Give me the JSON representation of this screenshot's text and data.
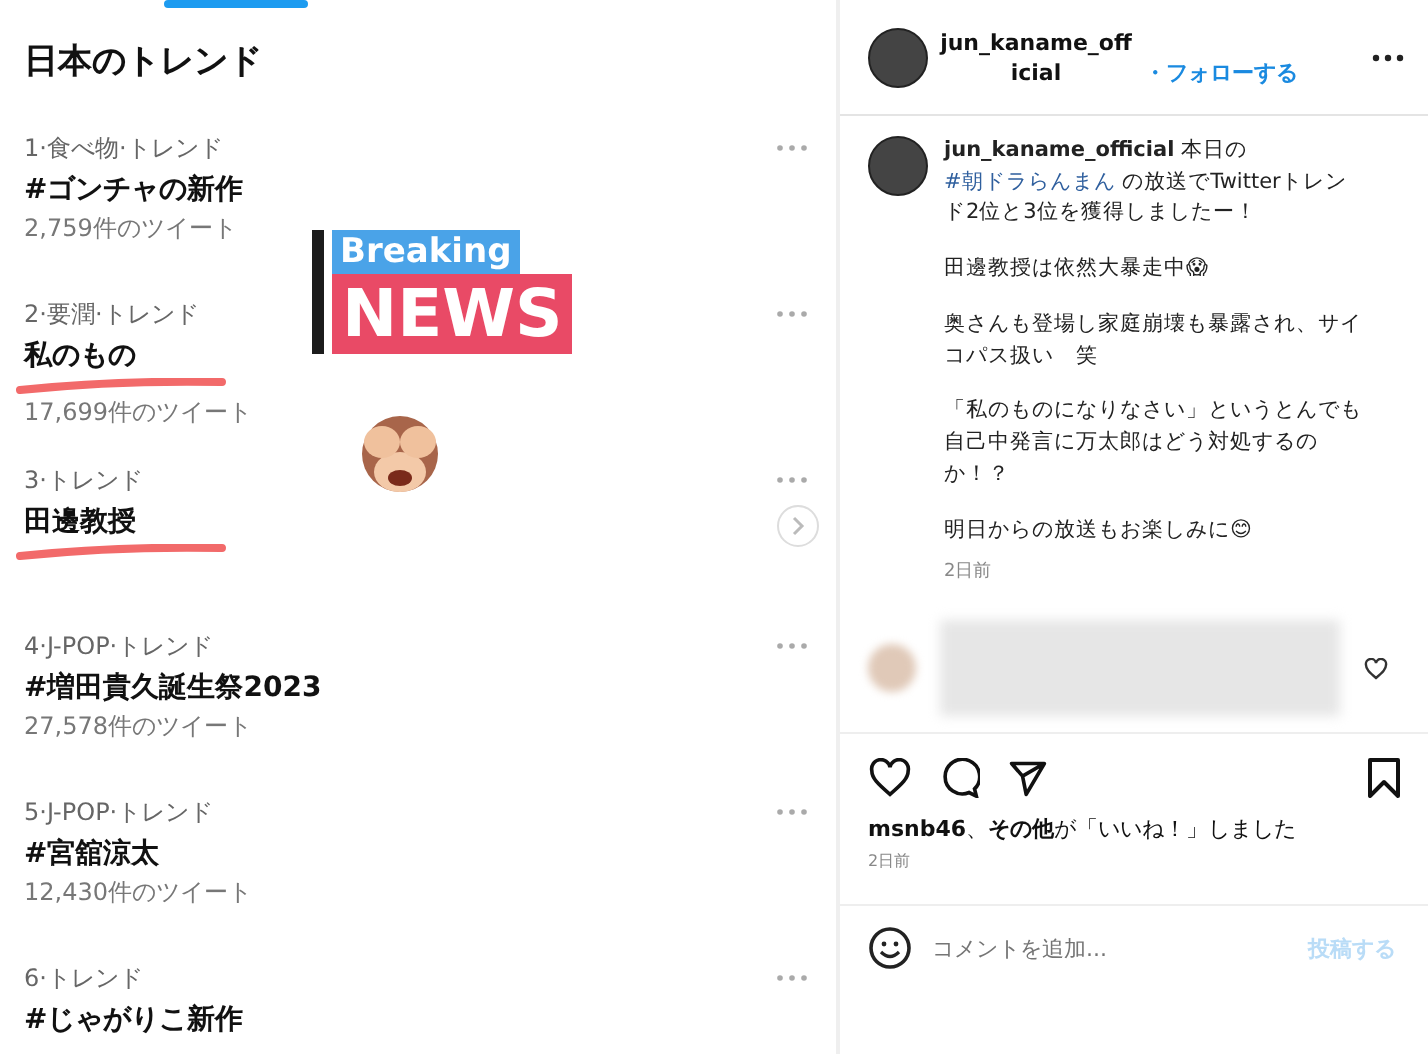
{
  "trends_panel": {
    "title": "日本のトレンド",
    "trends": [
      {
        "meta": "1·食べ物·トレンド",
        "name": "#ゴンチャの新作",
        "count": "2,759件のツイート",
        "underlined": false
      },
      {
        "meta": "2·要潤·トレンド",
        "name": "私のもの",
        "count": "17,699件のツイート",
        "underlined": true
      },
      {
        "meta": "3·トレンド",
        "name": "田邊教授",
        "underlined": true
      },
      {
        "meta": "4·J-POP·トレンド",
        "name": "#増田貴久誕生祭2023",
        "count": "27,578件のツイート",
        "underlined": false
      },
      {
        "meta": "5·J-POP·トレンド",
        "name": "#宮舘涼太",
        "count": "12,430件のツイート",
        "underlined": false
      },
      {
        "meta": "6·トレンド",
        "name": "#じゃがりこ新作",
        "underlined": false
      }
    ],
    "sticker": {
      "top": "Breaking",
      "bottom": "NEWS"
    }
  },
  "post_panel": {
    "header": {
      "username": "jun_kaname_official",
      "follow": "・フォローする"
    },
    "caption": {
      "username": "jun_kaname_official",
      "before": "本日の",
      "hashtag": "#朝ドラらんまん",
      "after": "の放送でTwitterトレンド2位と3位を獲得しましたー！",
      "paragraphs": [
        "田邊教授は依然大暴走中😱",
        "奥さんも登場し家庭崩壊も暴露され、サイコパス扱い　笑",
        "「私のものになりなさい」というとんでも自己中発言に万太郎はどう対処するのか！？",
        "明日からの放送もお楽しみに😊"
      ],
      "time": "2日前"
    },
    "likes": "**msnb46**、**その他**が「いいね！」しました",
    "time": "2日前",
    "comment": {
      "placeholder": "コメントを追加...",
      "post_button": "投稿する",
      "disabled": true
    }
  }
}
